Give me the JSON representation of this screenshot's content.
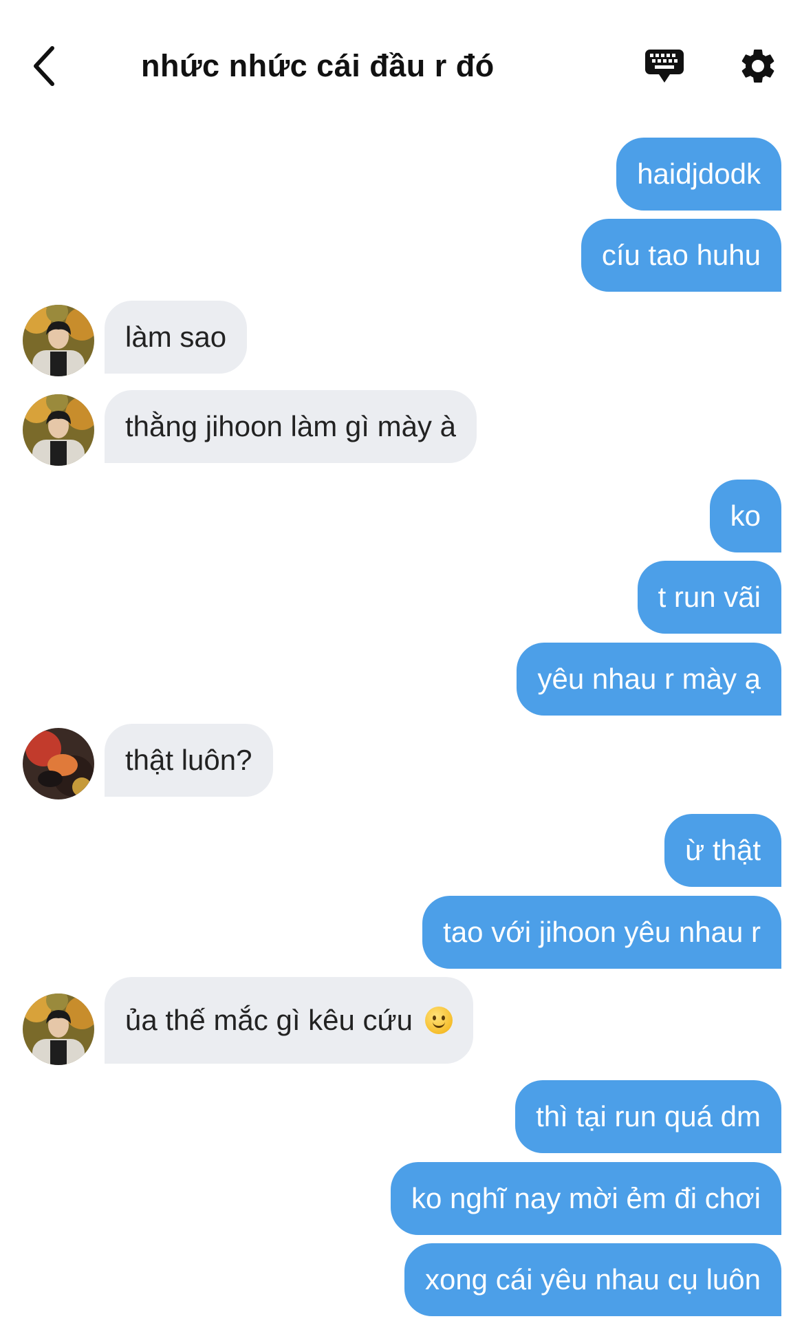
{
  "header": {
    "title": "nhức nhức cái đầu r đó",
    "back_icon": "chevron-left-icon",
    "keyboard_icon": "keyboard-icon",
    "settings_icon": "gear-icon"
  },
  "colors": {
    "outgoing_bubble": "#4c9fe8",
    "incoming_bubble": "#ebedf1"
  },
  "messages": [
    {
      "side": "out",
      "text": "haidjdodk"
    },
    {
      "side": "out",
      "text": "cíu tao huhu"
    },
    {
      "side": "in",
      "text": "làm sao"
    },
    {
      "side": "in",
      "text": "thằng jihoon làm gì mày à"
    },
    {
      "side": "out",
      "text": "ko"
    },
    {
      "side": "out",
      "text": "t run vãi"
    },
    {
      "side": "out",
      "text": "yêu nhau r mày ạ"
    },
    {
      "side": "in",
      "text": "thật luôn?"
    },
    {
      "side": "out",
      "text": "ừ thật"
    },
    {
      "side": "out",
      "text": "tao với jihoon yêu nhau r"
    },
    {
      "side": "in",
      "text": "ủa thế mắc gì kêu cứu",
      "emoji": "slightly-smiling-face-icon"
    },
    {
      "side": "out",
      "text": "thì tại run quá dm"
    },
    {
      "side": "out",
      "text": "ko nghĩ nay mời ẻm đi chơi"
    },
    {
      "side": "out",
      "text": "xong cái yêu nhau cụ luôn"
    }
  ]
}
